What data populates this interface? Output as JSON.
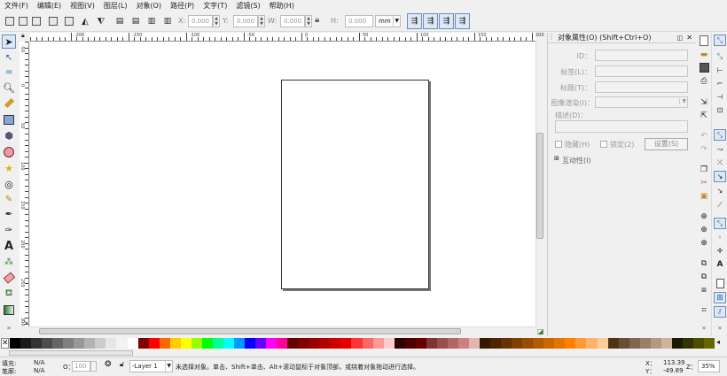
{
  "menu": [
    "文件(F)",
    "编辑(E)",
    "视图(V)",
    "图层(L)",
    "对象(O)",
    "路径(P)",
    "文字(T)",
    "滤镜(S)",
    "帮助(H)"
  ],
  "toolbar": {
    "x_label": "X:",
    "x_value": "0.000",
    "y_label": "Y:",
    "y_value": "0.000",
    "w_label": "W:",
    "w_value": "0.000",
    "h_label": "H:",
    "h_value": "0.000",
    "unit": "mm"
  },
  "ruler": {
    "h_labels": [
      "-200",
      "-150",
      "-100",
      "-50",
      "0",
      "50",
      "100",
      "150",
      "200",
      "250"
    ],
    "v_labels": [
      "-50",
      "0",
      "50",
      "100",
      "150",
      "200",
      "250",
      "300"
    ]
  },
  "panel": {
    "title": "对象属性(O) (Shift+Ctrl+O)",
    "id_label": "ID：",
    "tag_label": "标签(L)：",
    "title_label": "标题(T)：",
    "render_label": "图像渲染(I)：",
    "desc_label": "描述(D)：",
    "hide_label": "隐藏(H)",
    "lock_label": "锁定(2)",
    "set_button": "设置(S)",
    "interactive_label": "互动性(I)"
  },
  "status": {
    "fill_label": "填充:",
    "fill_value": "N/A",
    "stroke_label": "笔廓:",
    "stroke_value": "N/A",
    "opacity_label": "O：",
    "opacity_value": "100",
    "layer": "-Layer 1",
    "message": "未选择对象。单击、Shift+单击、Alt+滚动鼠标于对象顶部，或绕着对象拖动进行选择。",
    "x_label": "X：",
    "x_value": "113.39",
    "y_label": "Y：",
    "y_value": "-49.89",
    "zoom_label": "Z：",
    "zoom_value": "35%"
  },
  "palette_colors": [
    "#000000",
    "#1a1a1a",
    "#333333",
    "#4d4d4d",
    "#666666",
    "#808080",
    "#999999",
    "#b3b3b3",
    "#cccccc",
    "#e6e6e6",
    "#f2f2f2",
    "#ffffff",
    "#800000",
    "#ff0000",
    "#ff6600",
    "#ffcc00",
    "#ffff00",
    "#99ff00",
    "#00ff00",
    "#00ff99",
    "#00ffff",
    "#0099ff",
    "#0000ff",
    "#6600ff",
    "#ff00ff",
    "#ff0099",
    "#660000",
    "#800000",
    "#990000",
    "#b30000",
    "#cc0000",
    "#e60000",
    "#ff3333",
    "#ff6666",
    "#ff9999",
    "#ffcccc",
    "#330000",
    "#4d0000",
    "#660000",
    "#803333",
    "#994d4d",
    "#b36666",
    "#cc8080",
    "#e6b3b3",
    "#331a00",
    "#4d2600",
    "#663300",
    "#804000",
    "#994d00",
    "#b35900",
    "#cc6600",
    "#e67300",
    "#ff8000",
    "#ff9933",
    "#ffb366",
    "#ffcc99",
    "#4d3319",
    "#664d33",
    "#80664d",
    "#998066",
    "#b39980",
    "#ccb399",
    "#1a1a00",
    "#333300",
    "#4d4d00",
    "#666600"
  ]
}
